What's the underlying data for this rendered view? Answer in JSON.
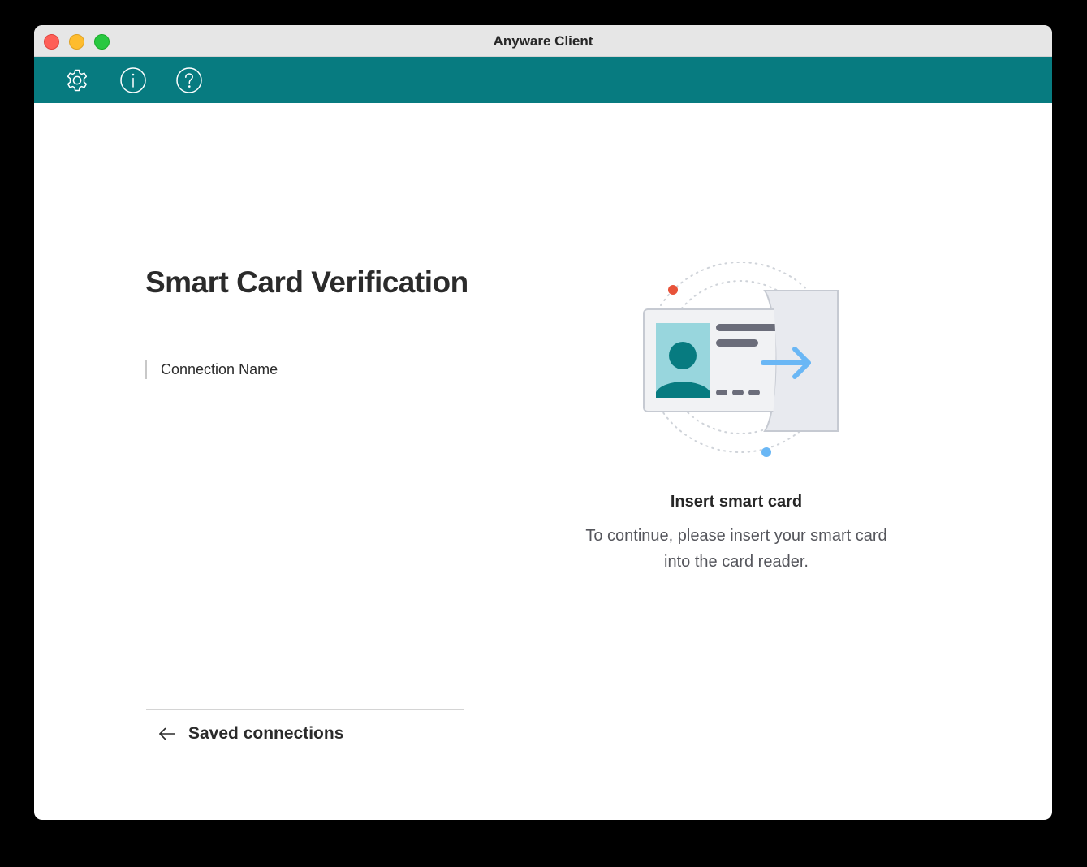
{
  "window": {
    "title": "Anyware Client"
  },
  "toolbar": {
    "icons": [
      "gear-icon",
      "info-icon",
      "help-icon"
    ],
    "color": "#077b80"
  },
  "main": {
    "page_title": "Smart Card Verification",
    "connection_name": "Connection Name",
    "back_link": "Saved connections"
  },
  "prompt": {
    "title": "Insert smart card",
    "description_line1": "To continue, please insert your smart card",
    "description_line2": "into the card reader."
  },
  "colors": {
    "accent": "#077b80",
    "illustration_photo": "#98d6dd",
    "illustration_arrow": "#6ab7f5",
    "illustration_dot_red": "#e8533a",
    "illustration_dot_blue": "#6ab7f5"
  }
}
